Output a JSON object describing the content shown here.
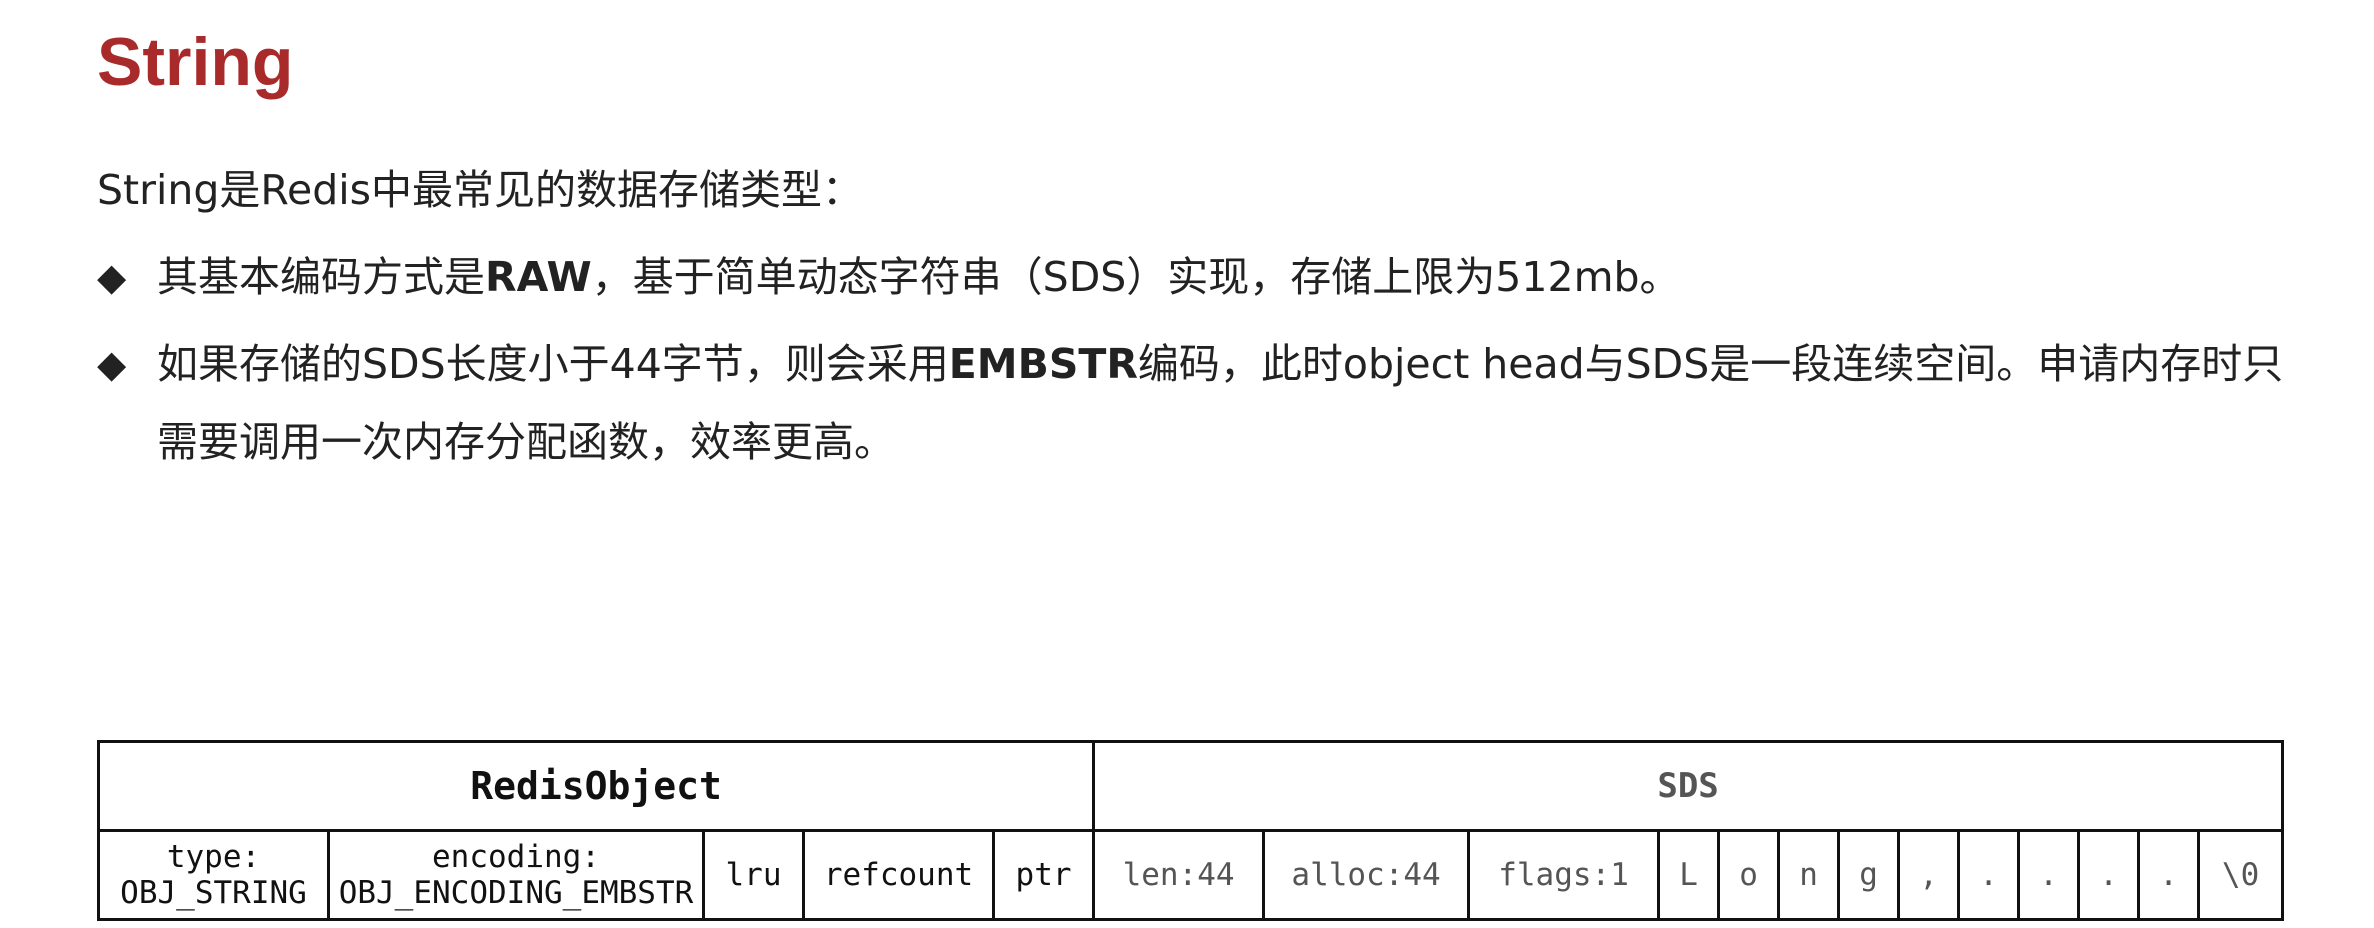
{
  "title": "String",
  "intro": "String是Redis中最常见的数据存储类型：",
  "bullet_marker": "◆",
  "bullets": [
    {
      "before": "其基本编码方式是",
      "bold": "RAW",
      "after": "，基于简单动态字符串（SDS）实现，存储上限为512mb。"
    },
    {
      "before": "如果存储的SDS长度小于44字节，则会采用",
      "bold": "EMBSTR",
      "after": "编码，此时object head与SDS是一段连续空间。申请内存时只需要调用一次内存分配函数，效率更高。"
    }
  ],
  "diagram": {
    "redis_object_header": "RedisObject",
    "sds_header": "SDS",
    "type_label": "type:",
    "type_value": "OBJ_STRING",
    "encoding_label": "encoding:",
    "encoding_value": "OBJ_ENCODING_EMBSTR",
    "lru": "lru",
    "refcount": "refcount",
    "ptr": "ptr",
    "len": "len:44",
    "alloc": "alloc:44",
    "flags": "flags:1",
    "chars": [
      "L",
      "o",
      "n",
      "g",
      ",",
      ".",
      ".",
      ".",
      ".",
      "\\0"
    ]
  }
}
